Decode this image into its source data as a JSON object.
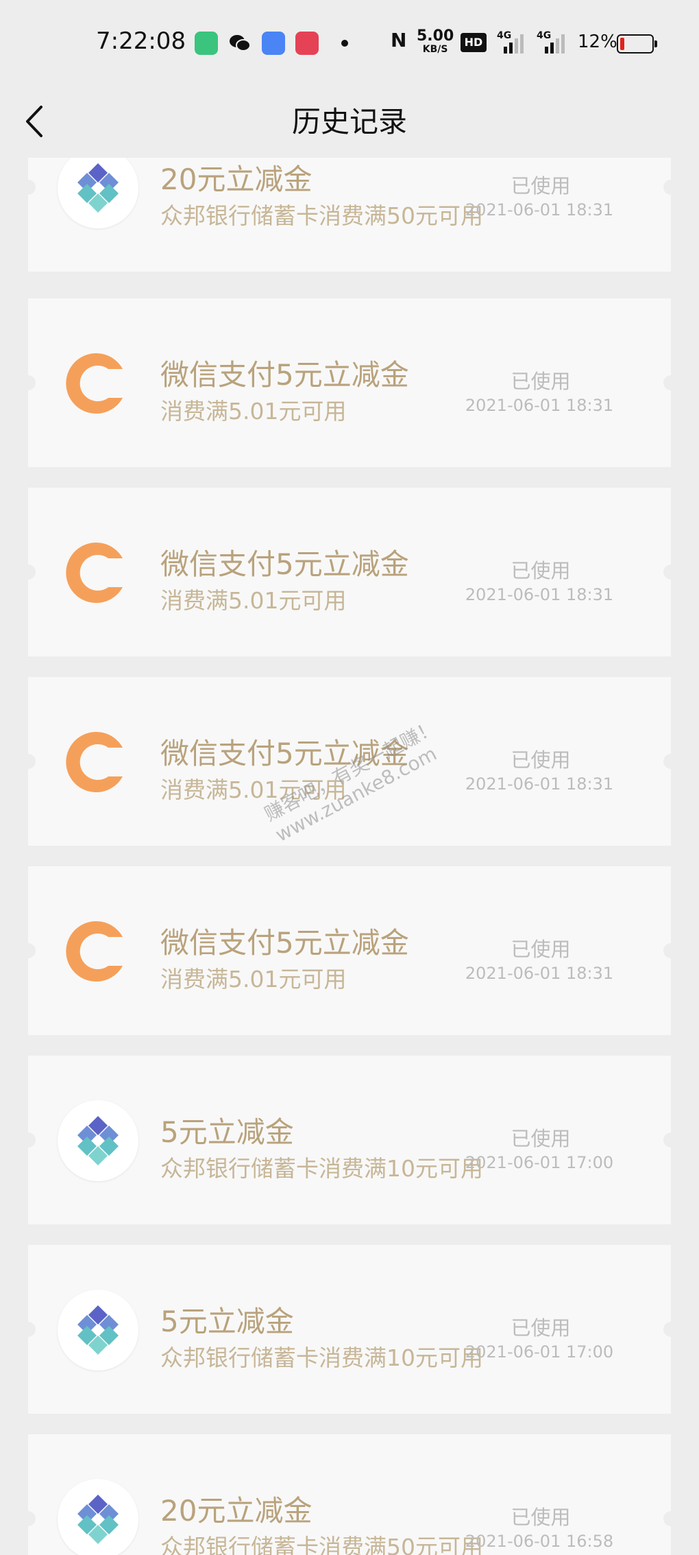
{
  "status_bar": {
    "time": "7:22:08",
    "net_speed": "5.00",
    "net_speed_unit": "KB/S",
    "hd_label": "HD",
    "net1_label": "4G",
    "net2_label": "4G",
    "battery": "12%"
  },
  "nav": {
    "title": "历史记录"
  },
  "cards": [
    {
      "title": "20元立减金",
      "desc": "众邦银行储蓄卡消费满50元可用",
      "status": "已使用",
      "time": "2021-06-01 18:31",
      "logo": "bank-logo"
    },
    {
      "title": "微信支付5元立减金",
      "desc": "消费满5.01元可用",
      "status": "已使用",
      "time": "2021-06-01 18:31",
      "logo": "wechat-c-logo"
    },
    {
      "title": "微信支付5元立减金",
      "desc": "消费满5.01元可用",
      "status": "已使用",
      "time": "2021-06-01 18:31",
      "logo": "wechat-c-logo"
    },
    {
      "title": "微信支付5元立减金",
      "desc": "消费满5.01元可用",
      "status": "已使用",
      "time": "2021-06-01 18:31",
      "logo": "wechat-c-logo"
    },
    {
      "title": "微信支付5元立减金",
      "desc": "消费满5.01元可用",
      "status": "已使用",
      "time": "2021-06-01 18:31",
      "logo": "wechat-c-logo"
    },
    {
      "title": "5元立减金",
      "desc": "众邦银行储蓄卡消费满10元可用",
      "status": "已使用",
      "time": "2021-06-01 17:00",
      "logo": "bank-logo"
    },
    {
      "title": "5元立减金",
      "desc": "众邦银行储蓄卡消费满10元可用",
      "status": "已使用",
      "time": "2021-06-01 17:00",
      "logo": "bank-logo"
    },
    {
      "title": "20元立减金",
      "desc": "众邦银行储蓄卡消费满50元可用",
      "status": "已使用",
      "time": "2021-06-01 16:58",
      "logo": "bank-logo"
    }
  ],
  "watermark": {
    "line1": "赚客吧，有奖一起赚！",
    "line2": "www.zuanke8.com"
  },
  "colors": {
    "background": "#ededed",
    "card": "#f8f8f8",
    "title": "#b9a27c",
    "desc": "#c7b697",
    "orange_logo": "#f5a05a",
    "status": "#bcbcbc"
  }
}
